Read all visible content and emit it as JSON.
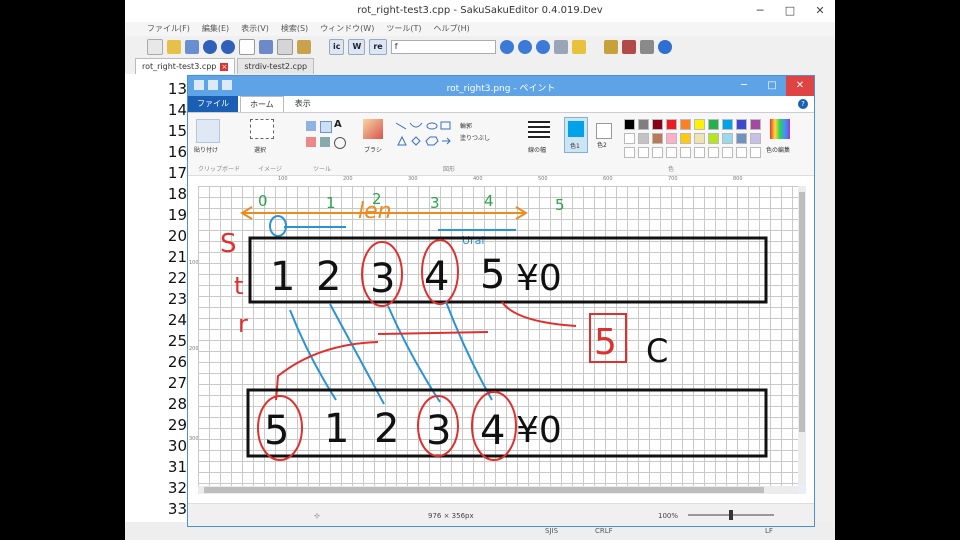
{
  "editor": {
    "title": "rot_right-test3.cpp - SakuSakuEditor 0.4.019.Dev",
    "menu": [
      "ファイル(F)",
      "編集(E)",
      "表示(V)",
      "検索(S)",
      "ウィンドウ(W)",
      "ツール(T)",
      "ヘルプ(H)"
    ],
    "toolbar_toggles": [
      "ic",
      "W",
      "re"
    ],
    "search_value": "f",
    "tabs": [
      {
        "label": "rot_right-test3.cpp",
        "active": true
      },
      {
        "label": "strdiv-test2.cpp",
        "active": false
      }
    ],
    "line_numbers": [
      "13",
      "14",
      "15",
      "16",
      "17",
      "18",
      "19",
      "20",
      "21",
      "22",
      "23",
      "24",
      "25",
      "26",
      "27",
      "28",
      "29",
      "30",
      "31",
      "32",
      "33"
    ],
    "status": [
      "SJIS",
      "CRLF",
      "LF"
    ]
  },
  "paint": {
    "title": "rot_right3.png - ペイント",
    "tabs": {
      "file": "ファイル",
      "home": "ホーム",
      "view": "表示"
    },
    "ribbon": {
      "clipboard": "クリップボード",
      "paste": "貼り付け",
      "image": "イメージ",
      "select": "選択",
      "tools": "ツール",
      "brushes": "ブラシ",
      "shapes": "図形",
      "outline": "輪郭",
      "fill": "塗りつぶし",
      "size": "線の幅",
      "color1": "色1",
      "color2": "色2",
      "colors": "色",
      "edit_colors": "色の編集"
    },
    "ruler_marks": [
      "100",
      "200",
      "300",
      "400",
      "500",
      "600",
      "700",
      "800"
    ],
    "vruler_marks": [
      "100",
      "200",
      "300"
    ],
    "status": {
      "dimensions": "976 × 356px",
      "zoom": "100%",
      "zoom_level": 1.0
    },
    "palette": [
      "#000000",
      "#7f7f7f",
      "#880015",
      "#ed1c24",
      "#ff7f27",
      "#fff200",
      "#22b14c",
      "#00a2e8",
      "#3f48cc",
      "#a349a4",
      "#ffffff",
      "#c3c3c3",
      "#b97a57",
      "#ffaec9",
      "#ffc90e",
      "#efe4b0",
      "#b5e61d",
      "#99d9ea",
      "#7092be",
      "#c8bfe7"
    ],
    "colors": {
      "color1": "#00a2e8",
      "color2": "#ffffff",
      "accent": "#1a5fb4"
    }
  },
  "drawing": {
    "top_indices": [
      "0",
      "1",
      "2",
      "3",
      "4",
      "5"
    ],
    "top_label": "len",
    "top_underline": "Urai",
    "left_labels": [
      "S",
      "t",
      "r"
    ],
    "row1_chars": [
      "1",
      "2",
      "3",
      "4",
      "5",
      "¥0"
    ],
    "row2_chars": [
      "5",
      "1",
      "2",
      "3",
      "4",
      "¥0"
    ],
    "temp_value": "5",
    "temp_label": "C"
  }
}
